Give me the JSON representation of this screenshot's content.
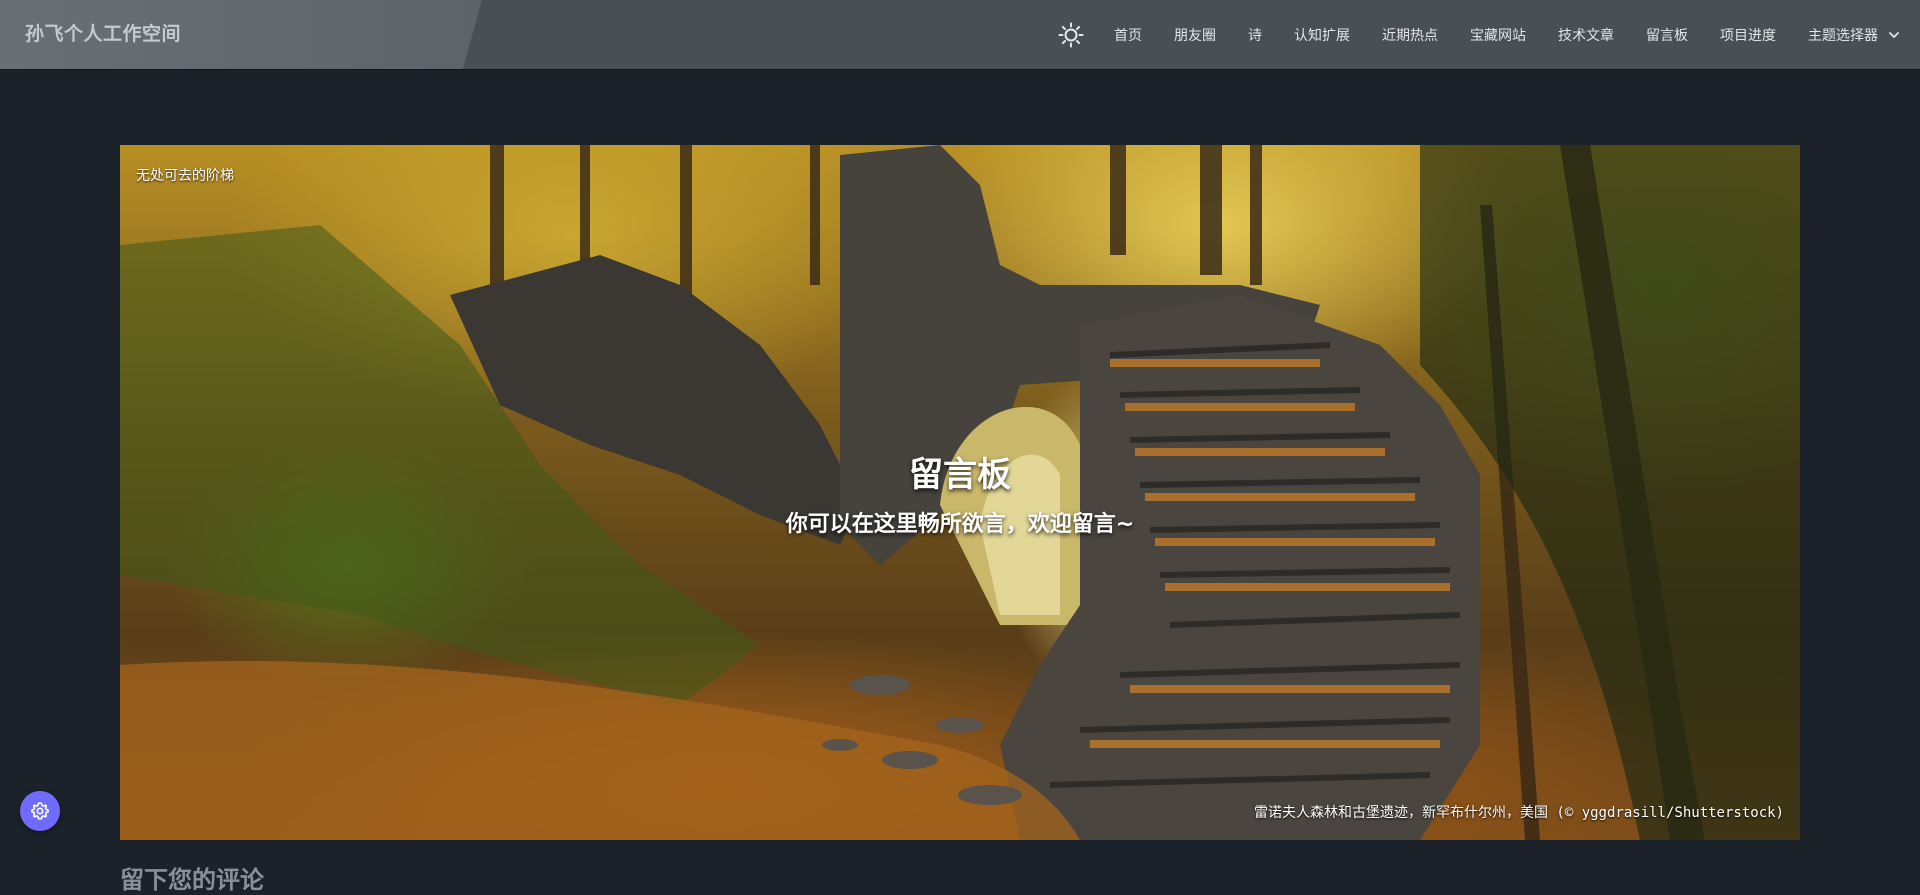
{
  "header": {
    "brand": "孙飞个人工作空间",
    "theme_icon": "sun-icon",
    "nav": [
      {
        "label": "首页"
      },
      {
        "label": "朋友圈"
      },
      {
        "label": "诗"
      },
      {
        "label": "认知扩展"
      },
      {
        "label": "近期热点"
      },
      {
        "label": "宝藏网站"
      },
      {
        "label": "技术文章"
      },
      {
        "label": "留言板"
      },
      {
        "label": "项目进度"
      },
      {
        "label": "主题选择器"
      }
    ]
  },
  "hero": {
    "image_caption": "无处可去的阶梯",
    "title": "留言板",
    "subtitle": "你可以在这里畅所欲言，欢迎留言~",
    "credit": "雷诺夫人森林和古堡遗迹，新罕布什尔州，美国 (© yggdrasill/Shutterstock)"
  },
  "comments": {
    "heading": "留下您的评论"
  },
  "settings_button": {
    "icon": "gear-icon",
    "color": "#6f6bff"
  },
  "colors": {
    "page_background": "#1b222a",
    "navbar": "#4a4f56"
  }
}
